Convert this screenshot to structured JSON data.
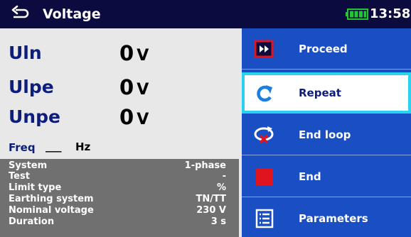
{
  "header": {
    "title": "Voltage",
    "time": "13:58",
    "back_icon": "back-arrow-icon",
    "battery_icon": "battery-full-icon"
  },
  "results": [
    {
      "label": "Uln",
      "value": "0",
      "unit": "V"
    },
    {
      "label": "Ulpe",
      "value": "0",
      "unit": "V"
    },
    {
      "label": "Unpe",
      "value": "0",
      "unit": "V"
    }
  ],
  "freq": {
    "label": "Freq",
    "value": "___",
    "unit": "Hz"
  },
  "parameters": [
    {
      "name": "System",
      "value": "1-phase"
    },
    {
      "name": "Test",
      "value": "-"
    },
    {
      "name": "Limit type",
      "value": "%"
    },
    {
      "name": "Earthing system",
      "value": "TN/TT"
    },
    {
      "name": "Nominal voltage",
      "value": "230 V"
    },
    {
      "name": "Duration",
      "value": "3 s"
    }
  ],
  "menu": {
    "items": [
      {
        "label": "Proceed",
        "icon": "proceed-icon"
      },
      {
        "label": "Repeat",
        "icon": "repeat-icon"
      },
      {
        "label": "End loop",
        "icon": "end-loop-icon"
      },
      {
        "label": "End",
        "icon": "stop-icon"
      },
      {
        "label": "Parameters",
        "icon": "parameters-icon"
      }
    ],
    "selected": "Repeat"
  },
  "colors": {
    "header_bg": "#0b0b3f",
    "menu_bg": "#1a4fc4",
    "selection_border": "#29d3f0",
    "label_blue": "#0d1e7a",
    "params_bg": "#707070",
    "stop_red": "#e0141e",
    "battery_green": "#22c532"
  }
}
